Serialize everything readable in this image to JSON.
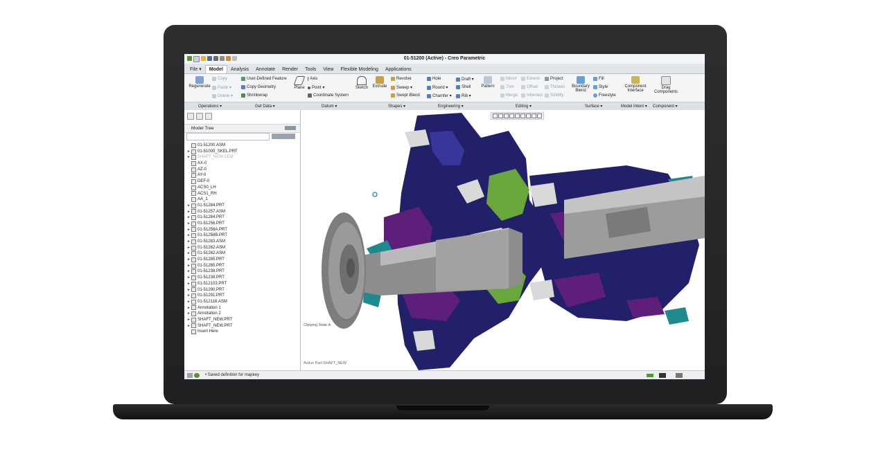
{
  "window": {
    "title": "01-51200 (Active) - Creo Parametric"
  },
  "tabs": [
    {
      "label": "File ▾"
    },
    {
      "label": "Model",
      "active": true
    },
    {
      "label": "Analysis"
    },
    {
      "label": "Annotate"
    },
    {
      "label": "Render"
    },
    {
      "label": "Tools"
    },
    {
      "label": "View"
    },
    {
      "label": "Flexible Modeling"
    },
    {
      "label": "Applications"
    }
  ],
  "ribbon": {
    "regenerate": "Regenerate",
    "copy": "Copy",
    "paste": "Paste ▾",
    "delete": "Delete ▾",
    "user_defined_feature": "User-Defined Feature",
    "copy_geometry": "Copy Geometry",
    "shrinkwrap": "Shrinkwrap",
    "plane": "Plane",
    "axis": "Axis",
    "point": "Point ▾",
    "coordinate_system": "Coordinate System",
    "sketch": "Sketch",
    "extrude": "Extrude",
    "revolve": "Revolve",
    "sweep": "Sweep ▾",
    "swept_blend": "Swept Blend",
    "hole": "Hole",
    "round": "Round ▾",
    "chamfer": "Chamfer ▾",
    "draft": "Draft ▾",
    "shell": "Shell",
    "rib": "Rib ▾",
    "pattern": "Pattern",
    "mirror": "Mirror",
    "trim": "Trim",
    "merge": "Merge",
    "extend": "Extend",
    "offset": "Offset",
    "intersect": "Intersect",
    "project": "Project",
    "thicken": "Thicken",
    "solidify": "Solidify",
    "boundary_blend_1": "Boundary",
    "boundary_blend_2": "Blend",
    "fill": "Fill",
    "style": "Style",
    "freestyle": "Freestyle",
    "component_interface_1": "Component",
    "component_interface_2": "Interface",
    "drag_components_1": "Drag",
    "drag_components_2": "Components"
  },
  "groups": [
    {
      "label": "Operations ▾"
    },
    {
      "label": "Get Data ▾"
    },
    {
      "label": "Datum ▾"
    },
    {
      "label": "Shapes ▾"
    },
    {
      "label": "Engineering ▾"
    },
    {
      "label": "Editing ▾"
    },
    {
      "label": "Surface ▾"
    },
    {
      "label": "Model Intent ▾"
    },
    {
      "label": "Component ▾"
    }
  ],
  "model_tree": {
    "title": "Model Tree",
    "items": [
      {
        "label": "01-51200.ASM",
        "arrow": ""
      },
      {
        "label": "01-51000_SKEL.PRT",
        "arrow": "►"
      },
      {
        "label": "SHAFT_NEW.CEM",
        "arrow": "►",
        "dim": true
      },
      {
        "label": "AX-0",
        "arrow": ""
      },
      {
        "label": "AZ-0",
        "arrow": ""
      },
      {
        "label": "AY-0",
        "arrow": ""
      },
      {
        "label": "DEF-0",
        "arrow": ""
      },
      {
        "label": "ACS0_LH",
        "arrow": ""
      },
      {
        "label": "ACS1_RH",
        "arrow": ""
      },
      {
        "label": "AA_1",
        "arrow": ""
      },
      {
        "label": "01-51284.PRT",
        "arrow": "►"
      },
      {
        "label": "01-51257.ASM",
        "arrow": "►"
      },
      {
        "label": "01-51284.PRT",
        "arrow": "►"
      },
      {
        "label": "01-51256.PRT",
        "arrow": "►"
      },
      {
        "label": "01-51258A.PRT",
        "arrow": "►"
      },
      {
        "label": "01-51258B.PRT",
        "arrow": "►"
      },
      {
        "label": "01-51283.ASM",
        "arrow": "►"
      },
      {
        "label": "01-51282.ASM",
        "arrow": "►"
      },
      {
        "label": "01-51282.ASM",
        "arrow": "►"
      },
      {
        "label": "01-51285.PRT",
        "arrow": "►"
      },
      {
        "label": "01-51285.PRT",
        "arrow": "►"
      },
      {
        "label": "01-51238.PRT",
        "arrow": "►"
      },
      {
        "label": "01-51238.PRT",
        "arrow": "►"
      },
      {
        "label": "01-512103.PRT",
        "arrow": "►"
      },
      {
        "label": "01-51290.PRT",
        "arrow": "►"
      },
      {
        "label": "01-51291.PRT",
        "arrow": "►"
      },
      {
        "label": "01-512118.ASM",
        "arrow": "►"
      },
      {
        "label": "Annotation 1",
        "arrow": "►"
      },
      {
        "label": "Annotation 2",
        "arrow": "►"
      },
      {
        "label": "SHAFT_NEW.PRT",
        "arrow": "►"
      },
      {
        "label": "SHAFT_NEW.PRT",
        "arrow": "►"
      },
      {
        "label": "Insert Here",
        "arrow": ""
      }
    ]
  },
  "viewport": {
    "clipping_label": "Clipping State A",
    "active_part": "Active Part:SHAFT_NEW"
  },
  "status": {
    "message": "Saved definition for mapkey"
  },
  "colors": {
    "navy": "#23206a",
    "purple": "#5e1f7a",
    "teal": "#1f8a8e",
    "green": "#69a63c",
    "grey": "#9a9a9a",
    "ribbon_bg": "#f4f5f7"
  }
}
